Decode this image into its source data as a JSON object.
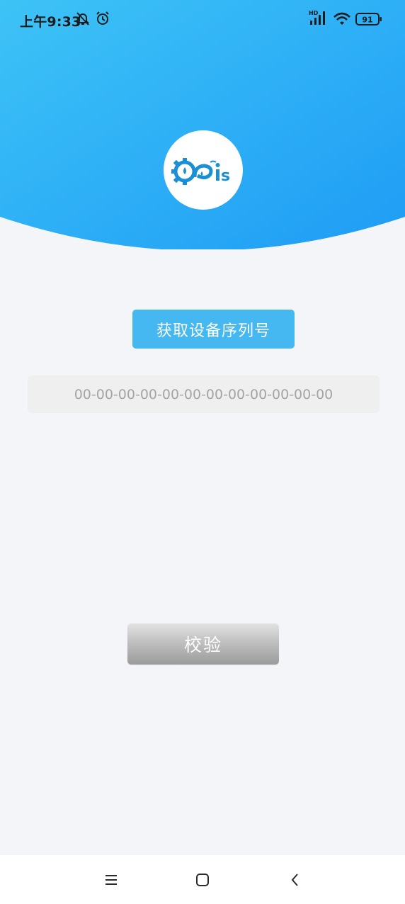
{
  "status_bar": {
    "time": "上午9:33",
    "network_label": "HD",
    "battery_level": "91",
    "icons": [
      "alarm-off-icon",
      "alarm-clock-icon",
      "signal-icon",
      "wifi-icon",
      "battery-icon"
    ]
  },
  "header": {
    "gradient_from": "#3ec3f6",
    "gradient_to": "#1e9cf5",
    "logo_text": "Cpis"
  },
  "actions": {
    "get_serial_label": "获取设备序列号",
    "verify_label": "校验"
  },
  "serial_field": {
    "placeholder": "00-00-00-00-00-00-00-00-00-00-00-00"
  },
  "navigation": {
    "items": [
      "menu-icon",
      "home-icon",
      "back-icon"
    ]
  },
  "colors": {
    "accent": "#45b8f1",
    "background": "#f3f5f9",
    "field_bg": "#efefef",
    "field_text": "#a4a4a4"
  }
}
